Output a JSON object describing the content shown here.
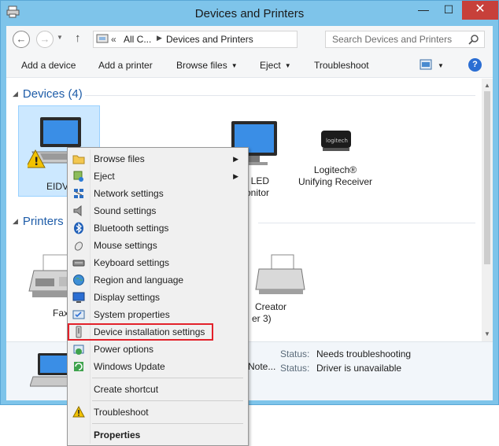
{
  "window": {
    "title": "Devices and Printers"
  },
  "controls": {
    "minimize": "—",
    "maximize": "☐",
    "close": "✕"
  },
  "nav": {
    "back_icon": "arrow-left-icon",
    "forward_icon": "arrow-right-icon",
    "up_icon": "arrow-up-icon",
    "chevron": "«",
    "breadcrumbs": [
      "All C...",
      "Devices and Printers"
    ],
    "search_placeholder": "Search Devices and Printers"
  },
  "commands": {
    "add_device": "Add a device",
    "add_printer": "Add a printer",
    "browse_files": "Browse files",
    "eject": "Eject",
    "troubleshoot": "Troubleshoot",
    "help": "?"
  },
  "groups": {
    "devices_header": "Devices (4)",
    "printers_header": "Printers ("
  },
  "devices": [
    {
      "label": "EIDV"
    },
    {
      "label": ""
    },
    {
      "label_line1": "2a LED",
      "label_line2": "lonitor"
    },
    {
      "label_line1": "Logitech®",
      "label_line2": "Unifying Receiver"
    }
  ],
  "printers": [
    {
      "label": "Fax"
    },
    {
      "label_line1": "Creator",
      "label_line2": "er 3)"
    }
  ],
  "details": {
    "name_partial": "Note...",
    "status_label_1": "Status:",
    "status_value_1": "Needs troubleshooting",
    "status_label_2": "Status:",
    "status_value_2": "Driver is unavailable"
  },
  "context_menu": {
    "items": [
      {
        "label": "Browse files",
        "icon": "folder-icon",
        "submenu": true
      },
      {
        "label": "Eject",
        "icon": "eject-icon",
        "submenu": true
      },
      {
        "label": "Network settings",
        "icon": "network-icon"
      },
      {
        "label": "Sound settings",
        "icon": "speaker-icon"
      },
      {
        "label": "Bluetooth settings",
        "icon": "bluetooth-icon"
      },
      {
        "label": "Mouse settings",
        "icon": "mouse-icon"
      },
      {
        "label": "Keyboard settings",
        "icon": "keyboard-icon"
      },
      {
        "label": "Region and language",
        "icon": "globe-icon"
      },
      {
        "label": "Display settings",
        "icon": "display-icon"
      },
      {
        "label": "System properties",
        "icon": "system-icon"
      },
      {
        "label": "Device installation settings",
        "icon": "device-install-icon",
        "highlighted": true
      },
      {
        "label": "Power options",
        "icon": "power-icon"
      },
      {
        "label": "Windows Update",
        "icon": "windows-update-icon"
      },
      {
        "label": "Create shortcut",
        "icon": ""
      },
      {
        "label": "Troubleshoot",
        "icon": "warning-icon"
      },
      {
        "label": "Properties",
        "icon": "",
        "bold": true
      }
    ]
  },
  "colors": {
    "window_frame": "#7ec4ea",
    "close_button": "#c7403a",
    "group_header": "#1e5ca8",
    "highlight_border": "#e3212a",
    "selection": "#cce8ff"
  }
}
